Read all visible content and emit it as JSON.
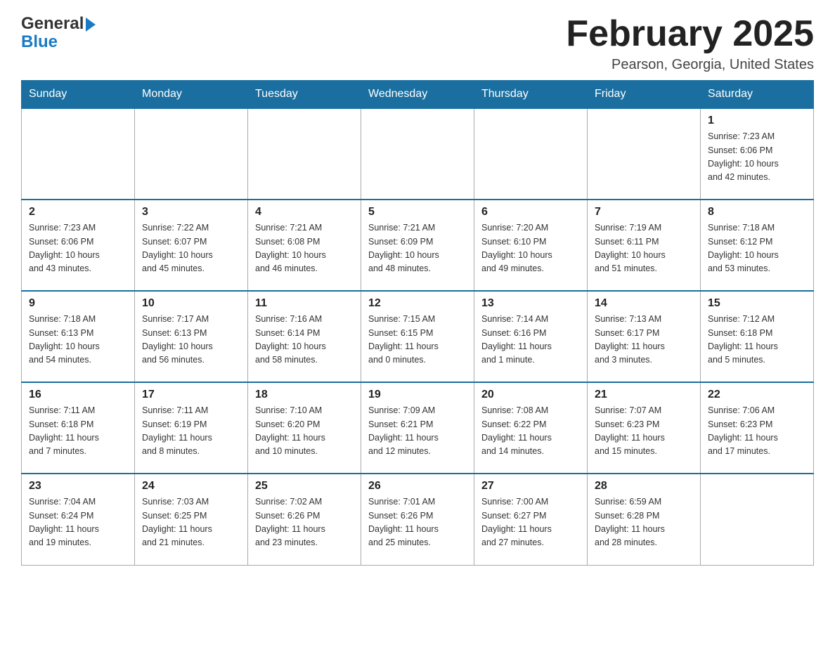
{
  "header": {
    "logo_general": "General",
    "logo_blue": "Blue",
    "month_title": "February 2025",
    "location": "Pearson, Georgia, United States"
  },
  "days_of_week": [
    "Sunday",
    "Monday",
    "Tuesday",
    "Wednesday",
    "Thursday",
    "Friday",
    "Saturday"
  ],
  "weeks": [
    [
      {
        "day": "",
        "info": ""
      },
      {
        "day": "",
        "info": ""
      },
      {
        "day": "",
        "info": ""
      },
      {
        "day": "",
        "info": ""
      },
      {
        "day": "",
        "info": ""
      },
      {
        "day": "",
        "info": ""
      },
      {
        "day": "1",
        "info": "Sunrise: 7:23 AM\nSunset: 6:06 PM\nDaylight: 10 hours\nand 42 minutes."
      }
    ],
    [
      {
        "day": "2",
        "info": "Sunrise: 7:23 AM\nSunset: 6:06 PM\nDaylight: 10 hours\nand 43 minutes."
      },
      {
        "day": "3",
        "info": "Sunrise: 7:22 AM\nSunset: 6:07 PM\nDaylight: 10 hours\nand 45 minutes."
      },
      {
        "day": "4",
        "info": "Sunrise: 7:21 AM\nSunset: 6:08 PM\nDaylight: 10 hours\nand 46 minutes."
      },
      {
        "day": "5",
        "info": "Sunrise: 7:21 AM\nSunset: 6:09 PM\nDaylight: 10 hours\nand 48 minutes."
      },
      {
        "day": "6",
        "info": "Sunrise: 7:20 AM\nSunset: 6:10 PM\nDaylight: 10 hours\nand 49 minutes."
      },
      {
        "day": "7",
        "info": "Sunrise: 7:19 AM\nSunset: 6:11 PM\nDaylight: 10 hours\nand 51 minutes."
      },
      {
        "day": "8",
        "info": "Sunrise: 7:18 AM\nSunset: 6:12 PM\nDaylight: 10 hours\nand 53 minutes."
      }
    ],
    [
      {
        "day": "9",
        "info": "Sunrise: 7:18 AM\nSunset: 6:13 PM\nDaylight: 10 hours\nand 54 minutes."
      },
      {
        "day": "10",
        "info": "Sunrise: 7:17 AM\nSunset: 6:13 PM\nDaylight: 10 hours\nand 56 minutes."
      },
      {
        "day": "11",
        "info": "Sunrise: 7:16 AM\nSunset: 6:14 PM\nDaylight: 10 hours\nand 58 minutes."
      },
      {
        "day": "12",
        "info": "Sunrise: 7:15 AM\nSunset: 6:15 PM\nDaylight: 11 hours\nand 0 minutes."
      },
      {
        "day": "13",
        "info": "Sunrise: 7:14 AM\nSunset: 6:16 PM\nDaylight: 11 hours\nand 1 minute."
      },
      {
        "day": "14",
        "info": "Sunrise: 7:13 AM\nSunset: 6:17 PM\nDaylight: 11 hours\nand 3 minutes."
      },
      {
        "day": "15",
        "info": "Sunrise: 7:12 AM\nSunset: 6:18 PM\nDaylight: 11 hours\nand 5 minutes."
      }
    ],
    [
      {
        "day": "16",
        "info": "Sunrise: 7:11 AM\nSunset: 6:18 PM\nDaylight: 11 hours\nand 7 minutes."
      },
      {
        "day": "17",
        "info": "Sunrise: 7:11 AM\nSunset: 6:19 PM\nDaylight: 11 hours\nand 8 minutes."
      },
      {
        "day": "18",
        "info": "Sunrise: 7:10 AM\nSunset: 6:20 PM\nDaylight: 11 hours\nand 10 minutes."
      },
      {
        "day": "19",
        "info": "Sunrise: 7:09 AM\nSunset: 6:21 PM\nDaylight: 11 hours\nand 12 minutes."
      },
      {
        "day": "20",
        "info": "Sunrise: 7:08 AM\nSunset: 6:22 PM\nDaylight: 11 hours\nand 14 minutes."
      },
      {
        "day": "21",
        "info": "Sunrise: 7:07 AM\nSunset: 6:23 PM\nDaylight: 11 hours\nand 15 minutes."
      },
      {
        "day": "22",
        "info": "Sunrise: 7:06 AM\nSunset: 6:23 PM\nDaylight: 11 hours\nand 17 minutes."
      }
    ],
    [
      {
        "day": "23",
        "info": "Sunrise: 7:04 AM\nSunset: 6:24 PM\nDaylight: 11 hours\nand 19 minutes."
      },
      {
        "day": "24",
        "info": "Sunrise: 7:03 AM\nSunset: 6:25 PM\nDaylight: 11 hours\nand 21 minutes."
      },
      {
        "day": "25",
        "info": "Sunrise: 7:02 AM\nSunset: 6:26 PM\nDaylight: 11 hours\nand 23 minutes."
      },
      {
        "day": "26",
        "info": "Sunrise: 7:01 AM\nSunset: 6:26 PM\nDaylight: 11 hours\nand 25 minutes."
      },
      {
        "day": "27",
        "info": "Sunrise: 7:00 AM\nSunset: 6:27 PM\nDaylight: 11 hours\nand 27 minutes."
      },
      {
        "day": "28",
        "info": "Sunrise: 6:59 AM\nSunset: 6:28 PM\nDaylight: 11 hours\nand 28 minutes."
      },
      {
        "day": "",
        "info": ""
      }
    ]
  ]
}
